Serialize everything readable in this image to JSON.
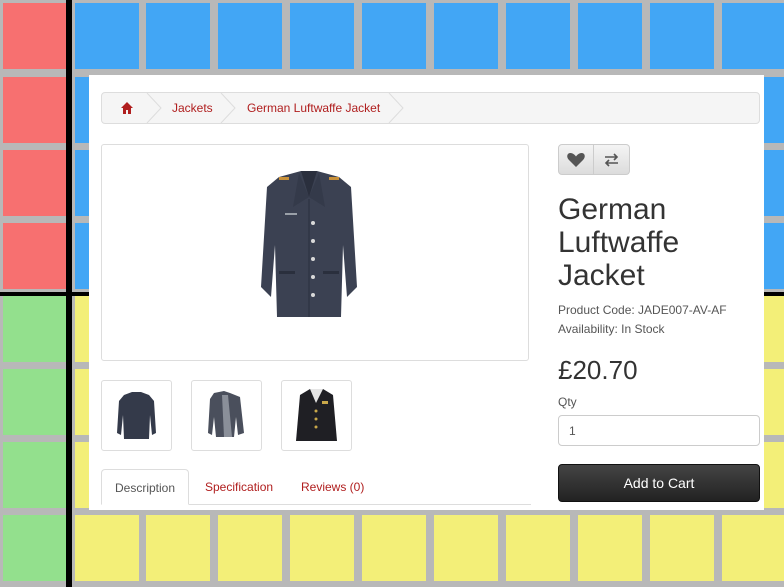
{
  "colors": {
    "grid_blue": "#42a6f5",
    "grid_red": "#f77070",
    "grid_green": "#93e08d",
    "grid_yellow": "#f3ef78",
    "grid_line": "#b8b8b8",
    "accent_red": "#b01e1e",
    "cart_button": "#2b2b2b"
  },
  "breadcrumb": {
    "home_icon": "home-icon",
    "items": [
      "Jackets",
      "German Luftwaffe Jacket"
    ]
  },
  "gallery": {
    "main_image": "jacket-front-image",
    "thumbnails": [
      "jacket-front-thumb",
      "jacket-open-thumb",
      "jacket-on-mannequin-thumb"
    ]
  },
  "actions": {
    "wishlist_icon": "heart-icon",
    "compare_icon": "compare-arrows-icon"
  },
  "product": {
    "title": "German Luftwaffe Jacket",
    "product_code": "Product Code: JADE007-AV-AF",
    "availability": "Availability: In Stock",
    "price": "£20.70",
    "qty_label": "Qty",
    "qty_value": "1",
    "add_to_cart": "Add to Cart"
  },
  "tabs": [
    "Description",
    "Specification",
    "Reviews (0)"
  ]
}
